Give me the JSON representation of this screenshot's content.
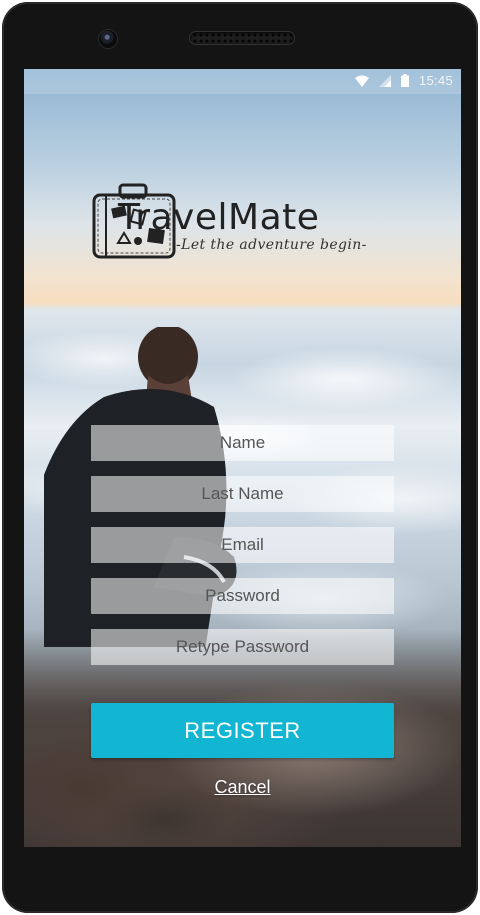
{
  "status_bar": {
    "time": "15:45"
  },
  "brand": {
    "name": "TravelMate",
    "tagline": "-Let the adventure begin-"
  },
  "form": {
    "name_placeholder": "Name",
    "last_name_placeholder": "Last Name",
    "email_placeholder": "Email",
    "password_placeholder": "Password",
    "retype_password_placeholder": "Retype Password"
  },
  "actions": {
    "register_label": "REGISTER",
    "cancel_label": "Cancel"
  },
  "colors": {
    "accent": "#13b6d2",
    "device": "#141414"
  },
  "icons": [
    "wifi-icon",
    "cell-signal-icon",
    "battery-icon",
    "suitcase-icon"
  ]
}
